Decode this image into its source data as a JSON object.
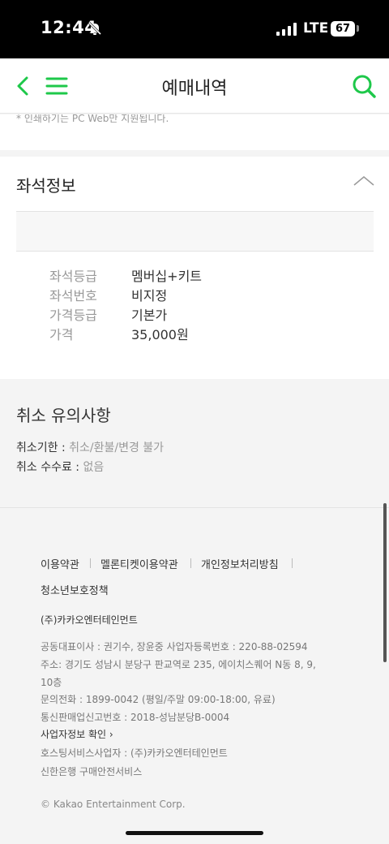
{
  "status_bar": {
    "time": "12:44",
    "network": "LTE",
    "battery": "67"
  },
  "nav": {
    "title": "예매내역"
  },
  "notice": {
    "cut_text": "* 인쇄하기는 PC Web만 지원됩니다."
  },
  "seat_info": {
    "title": "좌석정보",
    "rows": [
      {
        "label": "좌석등급",
        "value": "멤버십+키트"
      },
      {
        "label": "좌석번호",
        "value": "비지정"
      },
      {
        "label": "가격등급",
        "value": "기본가"
      },
      {
        "label": "가격",
        "value": "35,000원"
      }
    ]
  },
  "cancel": {
    "title": "취소 유의사항",
    "deadline_label": "취소기한 : ",
    "deadline_value": "취소/환불/변경 불가",
    "fee_label": "취소 수수료 : ",
    "fee_value": "없음"
  },
  "footer": {
    "links": [
      "이용약관",
      "멜론티켓이용약관",
      "개인정보처리방침",
      "청소년보호정책"
    ],
    "company": "(주)카카오엔터테인먼트",
    "ceo_line": "공동대표이사 : 권기수, 장윤중      사업자등록번호 : 220-88-02594",
    "address_line1": "주소: 경기도 성남시 분당구 판교역로 235, 에이치스퀘어 N동 8, 9,",
    "address_line2": "10층",
    "phone_line": "문의전화 : 1899-0042 (평일/주말 09:00-18:00, 유료)",
    "mail_order_line": "통신판매업신고번호 : 2018-성남분당B-0004",
    "biz_check": "사업자정보 확인 ›",
    "hosting_line": "호스팅서비스사업자 : (주)카카오엔터테인먼트",
    "escrow_line": "신한은행 구매안전서비스",
    "copyright": "© Kakao Entertainment Corp."
  },
  "colors": {
    "accent": "#1ec84a"
  }
}
